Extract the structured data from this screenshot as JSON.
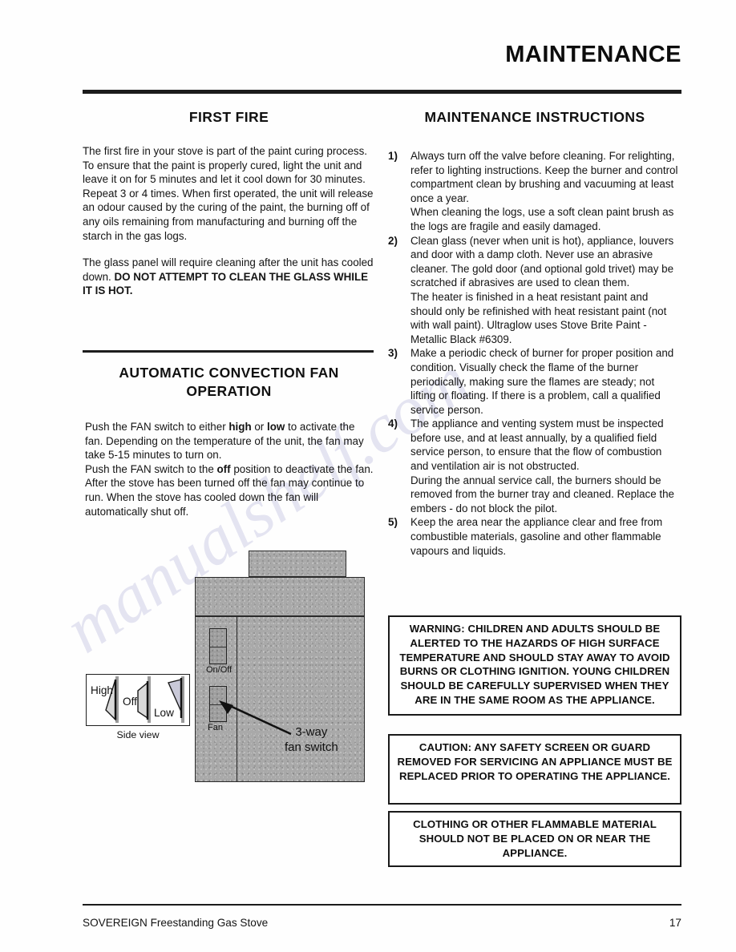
{
  "document": {
    "title": "MAINTENANCE",
    "watermark": "manualshelf.com"
  },
  "left_column": {
    "first_fire": {
      "heading": "FIRST FIRE",
      "paragraph_1": "The first fire in your stove is part of the paint curing process. To ensure that the paint is properly cured, light the unit and leave it on for 5 minutes and let it cool down for 30 minutes. Repeat 3 or 4 times. When first operated, the unit will release an odour caused by the curing of the paint, the burning off of any oils remaining from manufacturing and burning off the starch in the gas logs.",
      "paragraph_2_normal": "The glass panel will require cleaning after the unit has cooled down. ",
      "paragraph_2_bold": "DO NOT ATTEMPT TO CLEAN THE GLASS WHILE IT IS HOT."
    },
    "fan_section": {
      "heading_line_1": "AUTOMATIC CONVECTION FAN",
      "heading_line_2": "OPERATION",
      "p1_a": "Push the FAN switch to either ",
      "p1_b": "high",
      "p1_c": " or ",
      "p1_d": "low",
      "p1_e": " to activate the fan.  Depending on the temperature of the unit, the fan may take 5-15 minutes to turn on.",
      "p2_a": "Push the FAN switch to the ",
      "p2_b": "off",
      "p2_c": " position to deactivate the fan.",
      "p3": "After the stove has been turned off the fan may continue to run.  When the stove has cooled down the fan will automatically shut off."
    }
  },
  "diagram": {
    "callout_line_1": "3-way",
    "callout_line_2": "fan switch",
    "onoff_label": "On/Off",
    "fan_label": "Fan",
    "sideview_caption": "Side view",
    "sideview_positions": {
      "high": "High",
      "off": "Off",
      "low": "Low"
    }
  },
  "right_column": {
    "heading": "MAINTENANCE INSTRUCTIONS",
    "instructions": [
      {
        "number": "1)",
        "text": "Always turn off the valve before cleaning. For relighting, refer to lighting instructions. Keep the burner and control compartment clean by brushing and vacuuming at least once a year.\nWhen cleaning the logs, use a soft clean paint brush as the logs are fragile and easily damaged."
      },
      {
        "number": "2)",
        "text": "Clean glass (never when unit is hot), appliance, louvers and door with a damp cloth.  Never use an abrasive cleaner. The gold door (and optional gold trivet) may be scratched if abrasives are used to clean them.\nThe heater is finished in a heat resistant paint and should only be refinished with heat resistant paint (not with wall paint). Ultraglow uses Stove Brite Paint - Metallic Black #6309."
      },
      {
        "number": "3)",
        "text": "Make a  periodic check of burner for proper position and condition. Visually check the flame of the burner periodically, making sure the flames are steady; not lifting or floating. If there is a problem, call a qualified service person."
      },
      {
        "number": "4)",
        "text": "The appliance and venting system must be inspected before use, and at least annually, by a qualified field service person, to ensure that the flow of combustion and ventilation air is not obstructed.\nDuring the annual service call, the burners should be removed from the burner tray and cleaned. Replace the embers - do not block the pilot."
      },
      {
        "number": "5)",
        "text": "Keep the area near the appliance clear and free from combustible materials, gasoline and other flammable vapours and liquids."
      }
    ],
    "warnings": [
      "WARNING:  CHILDREN AND ADULTS SHOULD BE ALERTED TO THE HAZARDS OF HIGH SURFACE TEMPERATURE AND SHOULD STAY AWAY TO AVOID BURNS OR CLOTHING IGNITION.  YOUNG CHILDREN SHOULD BE CAREFULLY SUPERVISED WHEN THEY ARE IN THE SAME ROOM AS THE APPLIANCE.",
      "CAUTION:  ANY SAFETY SCREEN OR GUARD REMOVED FOR SERVICING AN APPLIANCE MUST BE REPLACED PRIOR TO OPERATING THE APPLIANCE.",
      "CLOTHING OR OTHER FLAMMABLE MATERIAL SHOULD NOT BE PLACED ON OR NEAR THE APPLIANCE."
    ]
  },
  "footer": {
    "brand": "SOVEREIGN",
    "product": " Freestanding Gas Stove",
    "page_number": "17"
  }
}
